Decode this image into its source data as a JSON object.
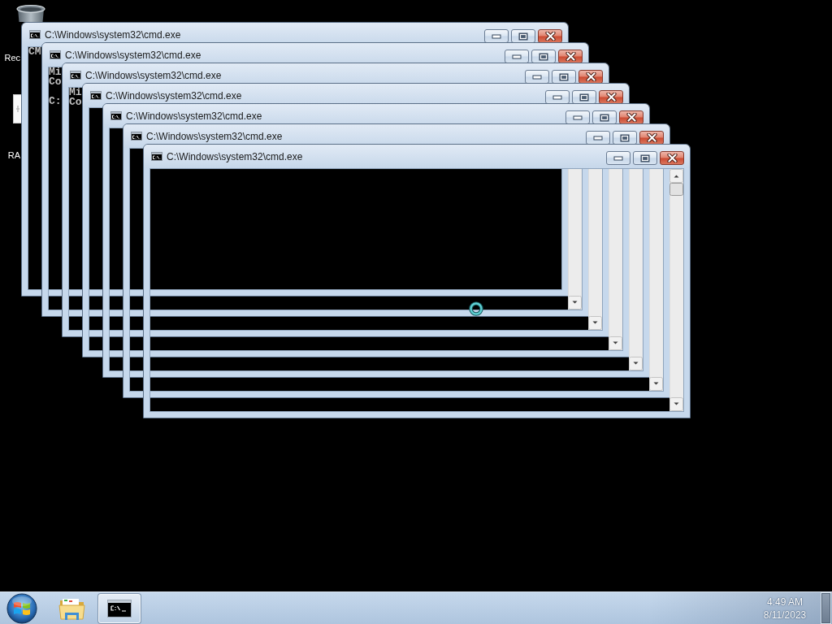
{
  "desktop": {
    "icons": [
      {
        "kind": "recycle_bin",
        "label": "Rec"
      },
      {
        "kind": "document",
        "label": "RA"
      }
    ]
  },
  "windows": [
    {
      "title": "C:\\Windows\\system32\\cmd.exe",
      "output": [
        "CM"
      ],
      "scrollbar": false
    },
    {
      "title": "C:\\Windows\\system32\\cmd.exe",
      "output": [
        "Mi",
        "Co"
      ],
      "prompt": "C:",
      "scrollbar": true
    },
    {
      "title": "C:\\Windows\\system32\\cmd.exe",
      "output": [
        "Mi",
        "Co"
      ],
      "scrollbar": true
    },
    {
      "title": "C:\\Windows\\system32\\cmd.exe",
      "scrollbar": true
    },
    {
      "title": "C:\\Windows\\system32\\cmd.exe",
      "scrollbar": true
    },
    {
      "title": "C:\\Windows\\system32\\cmd.exe",
      "scrollbar": true
    },
    {
      "title": "C:\\Windows\\system32\\cmd.exe",
      "scrollbar": true
    }
  ],
  "taskbar": {
    "items": [
      {
        "kind": "folder",
        "running": false
      },
      {
        "kind": "console",
        "running": true
      }
    ],
    "clock": {
      "time": "4:49 AM",
      "date": "8/11/2023"
    }
  }
}
